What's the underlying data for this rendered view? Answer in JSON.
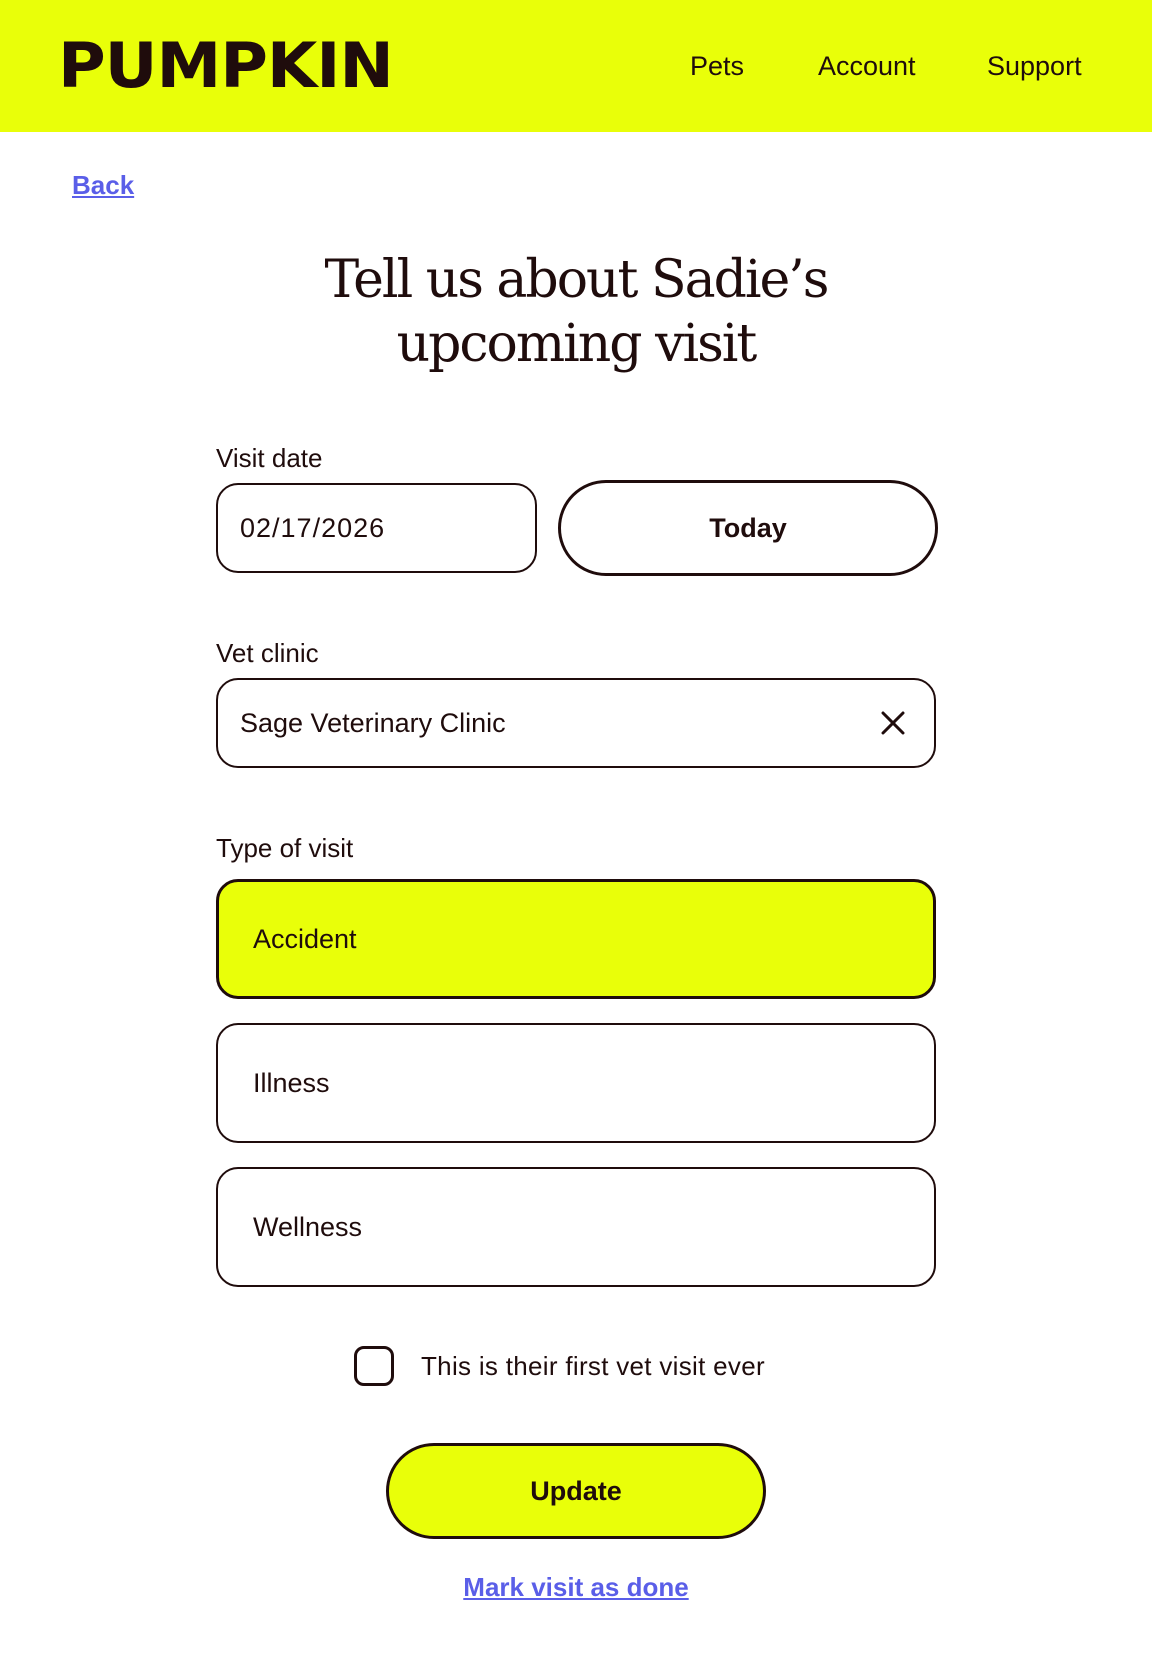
{
  "header": {
    "logo": "PUMPKIN",
    "nav": {
      "pets": "Pets",
      "account": "Account",
      "support": "Support"
    }
  },
  "back_label": "Back",
  "title_line1": "Tell us about Sadie’s",
  "title_line2": "upcoming visit",
  "visit_date": {
    "label": "Visit date",
    "value": "02/17/2026",
    "today_button": "Today"
  },
  "vet_clinic": {
    "label": "Vet clinic",
    "value": "Sage Veterinary Clinic",
    "clear_icon": "close-icon"
  },
  "visit_type": {
    "label": "Type of visit",
    "options": [
      "Accident",
      "Illness",
      "Wellness"
    ],
    "selected": "Accident"
  },
  "first_visit": {
    "label": "This is their first vet visit ever",
    "checked": false
  },
  "update_button": "Update",
  "mark_done_link": "Mark visit as done",
  "colors": {
    "brand": "#e9ff09",
    "text": "#1f0c0c",
    "link": "#5a5ee8"
  }
}
